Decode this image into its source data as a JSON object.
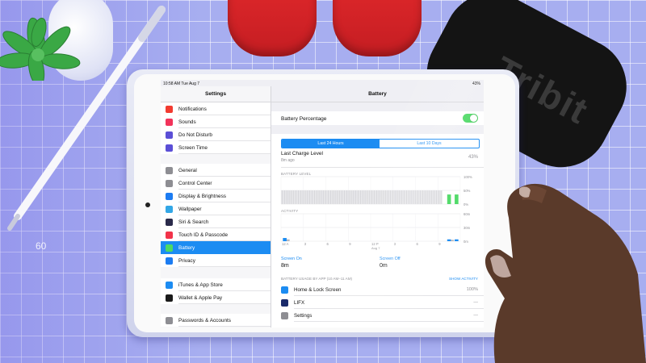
{
  "background": {
    "mat_number": "60"
  },
  "speaker": {
    "brand": "Tribit"
  },
  "status_bar": {
    "time": "10:58 AM   Tue Aug 7",
    "battery": "43%"
  },
  "sidebar": {
    "title": "Settings",
    "items": [
      {
        "label": "Notifications",
        "icon": "notifications-icon",
        "color": "#f23b30"
      },
      {
        "label": "Sounds",
        "icon": "sounds-icon",
        "color": "#f2335a"
      },
      {
        "label": "Do Not Disturb",
        "icon": "moon-icon",
        "color": "#5b4fd6"
      },
      {
        "label": "Screen Time",
        "icon": "hourglass-icon",
        "color": "#5b4fd6"
      },
      {
        "label": "General",
        "icon": "gear-icon",
        "color": "#8e8e93"
      },
      {
        "label": "Control Center",
        "icon": "switches-icon",
        "color": "#8e8e93"
      },
      {
        "label": "Display & Brightness",
        "icon": "aa-icon",
        "color": "#1c7cf2"
      },
      {
        "label": "Wallpaper",
        "icon": "wallpaper-icon",
        "color": "#33a7e6"
      },
      {
        "label": "Siri & Search",
        "icon": "siri-icon",
        "color": "#2a2a4a"
      },
      {
        "label": "Touch ID & Passcode",
        "icon": "fingerprint-icon",
        "color": "#f2334a"
      },
      {
        "label": "Battery",
        "icon": "battery-icon",
        "color": "#4cd964",
        "selected": true
      },
      {
        "label": "Privacy",
        "icon": "hand-icon",
        "color": "#1c7cf2"
      },
      {
        "label": "iTunes & App Store",
        "icon": "app-store-icon",
        "color": "#1c8cf2"
      },
      {
        "label": "Wallet & Apple Pay",
        "icon": "wallet-icon",
        "color": "#1a1a1a"
      },
      {
        "label": "Passwords & Accounts",
        "icon": "key-icon",
        "color": "#8e8e93"
      }
    ]
  },
  "detail": {
    "title": "Battery",
    "battery_percentage_label": "Battery Percentage",
    "battery_percentage_on": true,
    "tabs": [
      "Last 24 Hours",
      "Last 10 Days"
    ],
    "active_tab": 0,
    "last_charge_label": "Last Charge Level",
    "last_charge_sub": "8m ago",
    "last_charge_value": "43%",
    "battery_level_label": "BATTERY LEVEL",
    "activity_label": "ACTIVITY",
    "screen_on_label": "Screen On",
    "screen_on_value": "8m",
    "screen_off_label": "Screen Off",
    "screen_off_value": "0m",
    "usage_header": "BATTERY USAGE BY APP (10 AM–11 AM)",
    "show_activity": "SHOW ACTIVITY",
    "apps": [
      {
        "name": "Home & Lock Screen",
        "value": "100%",
        "icon": "home-lock-icon",
        "color": "#1c8cf2"
      },
      {
        "name": "LIFX",
        "value": "—",
        "icon": "lifx-icon",
        "color": "#1a2a6a"
      },
      {
        "name": "Settings",
        "value": "—",
        "icon": "settings-gear-icon",
        "color": "#8e8e93"
      }
    ]
  },
  "chart_data": [
    {
      "type": "bar",
      "title": "BATTERY LEVEL",
      "y_ticks": [
        "100%",
        "50%",
        "0%"
      ],
      "ylim": [
        0,
        100
      ],
      "values_description_note": null,
      "categories_count": 24,
      "values": [
        0,
        0,
        0,
        0,
        0,
        0,
        0,
        0,
        0,
        0,
        0,
        0,
        0,
        0,
        0,
        0,
        0,
        0,
        0,
        0,
        0,
        0,
        35,
        35
      ],
      "grid": true
    },
    {
      "type": "bar",
      "title": "ACTIVITY",
      "x_ticks": [
        "12 A",
        "3",
        "6",
        "9",
        "12 P",
        "3",
        "6",
        "9"
      ],
      "x_date_label": "Aug 7",
      "y_ticks": [
        "60m",
        "30m",
        "0m"
      ],
      "ylim": [
        0,
        60
      ],
      "values": [
        7,
        0,
        0,
        0,
        0,
        0,
        0,
        0,
        0,
        0,
        0,
        0,
        0,
        0,
        0,
        0,
        0,
        0,
        0,
        0,
        0,
        0,
        4,
        4
      ],
      "grid": true
    }
  ]
}
